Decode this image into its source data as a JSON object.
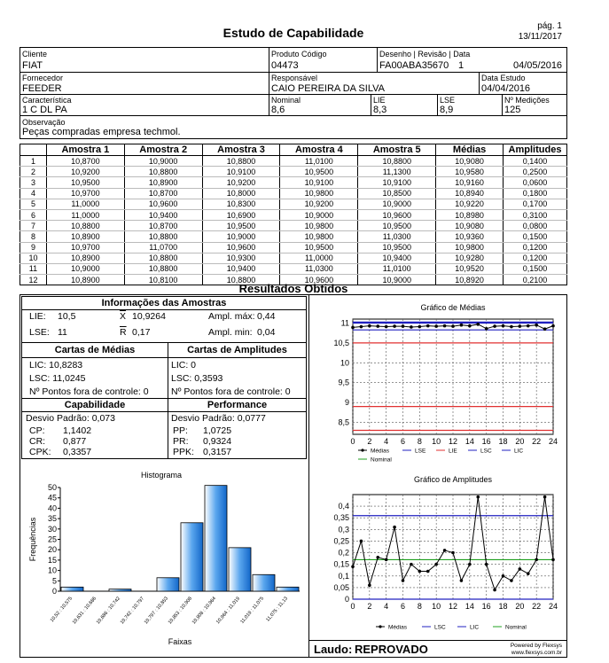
{
  "header": {
    "title": "Estudo de Capabilidade",
    "page": "pág. 1",
    "date": "13/11/2017"
  },
  "info": {
    "cliente_label": "Cliente",
    "cliente": "FIAT",
    "produto_label": "Produto Código",
    "produto": "04473",
    "desenho_label": "Desenho | Revisão | Data",
    "desenho": "FA00ABA35670",
    "revisao": "1",
    "desenho_data": "04/05/2016",
    "fornecedor_label": "Fornecedor",
    "fornecedor": "FEEDER",
    "responsavel_label": "Responsável",
    "responsavel": "CAIO PEREIRA DA SILVA",
    "data_estudo_label": "Data Estudo",
    "data_estudo": "04/04/2016",
    "caracteristica_label": "Característica",
    "caracteristica": "1  C DL PA",
    "nominal_label": "Nominal",
    "nominal": "8,6",
    "lie_label": "LIE",
    "lie": "8,3",
    "lse_label": "LSE",
    "lse": "8,9",
    "medicoes_label": "Nº Medições",
    "medicoes": "125",
    "obs_label": "Observação",
    "obs": "Peças compradas empresa techmol."
  },
  "table": {
    "headers": [
      "",
      "Amostra 1",
      "Amostra 2",
      "Amostra 3",
      "Amostra 4",
      "Amostra 5",
      "Médias",
      "Amplitudes"
    ],
    "rows": [
      [
        "1",
        "10,8700",
        "10,9000",
        "10,8800",
        "11,0100",
        "10,8800",
        "10,9080",
        "0,1400"
      ],
      [
        "2",
        "10,9200",
        "10,8800",
        "10,9100",
        "10,9500",
        "11,1300",
        "10,9580",
        "0,2500"
      ],
      [
        "3",
        "10,9500",
        "10,8900",
        "10,9200",
        "10,9100",
        "10,9100",
        "10,9160",
        "0,0600"
      ],
      [
        "4",
        "10,9700",
        "10,8700",
        "10,8000",
        "10,9800",
        "10,8500",
        "10,8940",
        "0,1800"
      ],
      [
        "5",
        "11,0000",
        "10,9600",
        "10,8300",
        "10,9200",
        "10,9000",
        "10,9220",
        "0,1700"
      ],
      [
        "6",
        "11,0000",
        "10,9400",
        "10,6900",
        "10,9000",
        "10,9600",
        "10,8980",
        "0,3100"
      ],
      [
        "7",
        "10,8800",
        "10,8700",
        "10,9500",
        "10,9800",
        "10,9500",
        "10,9080",
        "0,0800"
      ],
      [
        "8",
        "10,8900",
        "10,8800",
        "10,9000",
        "10,9800",
        "11,0300",
        "10,9360",
        "0,1500"
      ],
      [
        "9",
        "10,9700",
        "11,0700",
        "10,9600",
        "10,9500",
        "10,9500",
        "10,9800",
        "0,1200"
      ],
      [
        "10",
        "10,8900",
        "10,8800",
        "10,9300",
        "11,0000",
        "10,9400",
        "10,9280",
        "0,1200"
      ],
      [
        "11",
        "10,9000",
        "10,8800",
        "10,9400",
        "11,0300",
        "11,0100",
        "10,9520",
        "0,1500"
      ],
      [
        "12",
        "10,8900",
        "10,8100",
        "10,8800",
        "10,9600",
        "10,9000",
        "10,8920",
        "0,2100"
      ]
    ]
  },
  "results": {
    "title": "Resultados Obtidos",
    "info_title": "Informações das Amostras",
    "lie_l": "LIE:",
    "lie_v": "10,5",
    "xbar_l": "X",
    "xbar_v": "10,9264",
    "amax_l": "Ampl. máx:",
    "amax_v": "0,44",
    "lse_l": "LSE:",
    "lse_v": "11",
    "rbar_l": "R",
    "rbar_v": "0,17",
    "amin_l": "Ampl. min:",
    "amin_v": "0,04",
    "cm_title": "Cartas de Médias",
    "ca_title": "Cartas de Amplitudes",
    "cm_lic": "LIC:  10,8283",
    "cm_lsc": "LSC: 11,0245",
    "cm_pts": "Nº Pontos fora de controle: 0",
    "ca_lic": "LIC:  0",
    "ca_lsc": "LSC: 0,3593",
    "ca_pts": "Nº Pontos fora de controle: 0",
    "cap_title": "Capabilidade",
    "perf_title": "Performance",
    "cap_dp": "Desvio Padrão: 0,073",
    "perf_dp": "Desvio Padrão: 0,0777",
    "cp_l": "CP:",
    "cp_v": "1,1402",
    "cr_l": "CR:",
    "cr_v": "0,877",
    "cpk_l": "CPK:",
    "cpk_v": "0,3357",
    "pp_l": "PP:",
    "pp_v": "1,0725",
    "pr_l": "PR:",
    "pr_v": "0,9324",
    "ppk_l": "PPK:",
    "ppk_v": "0,3157",
    "laudo_l": "Laudo:",
    "laudo_v": "REPROVADO",
    "powered": "Powered by Flexsys",
    "site": "www.flexsys.com.br"
  },
  "chart_data": [
    {
      "type": "bar",
      "title": "Histograma",
      "xlabel": "Faixas",
      "ylabel": "Frequências",
      "ylim": [
        0,
        50
      ],
      "categories": [
        "10,52 : 10,575",
        "10,631 : 10,686",
        "10,686 : 10,742",
        "10,742 : 10,797",
        "10,797 : 10,853",
        "10,853 : 10,908",
        "10,908 : 10,964",
        "10,964 : 11,019",
        "11,019 : 11,075",
        "11,075 : 11,13"
      ],
      "values": [
        2,
        0,
        1,
        0,
        6.5,
        33,
        51,
        21,
        8,
        2
      ],
      "yticks": [
        "0",
        "5",
        "10",
        "15",
        "20",
        "25",
        "30",
        "35",
        "40",
        "45",
        "50"
      ],
      "xticks": [
        "10,52 : 10,575",
        "10,631 : 10,686",
        "10,686 : 10,742",
        "10,742 : 10,797",
        "10,797 : 10,853",
        "10,853 : 10,908",
        "10,908 : 10,964",
        "10,964 : 11,019",
        "11,019 : 11,075",
        "11,075 : 11,13"
      ]
    },
    {
      "type": "line",
      "title": "Gráfico de Médias",
      "ylim": [
        8.2,
        11.1
      ],
      "xlim": [
        0,
        24
      ],
      "xticks": [
        "0",
        "2",
        "4",
        "6",
        "8",
        "10",
        "12",
        "14",
        "16",
        "18",
        "20",
        "22",
        "24"
      ],
      "yticks": [
        "8,5",
        "9",
        "9,5",
        "10",
        "10,5",
        "11"
      ],
      "x": [
        0,
        1,
        2,
        3,
        4,
        5,
        6,
        7,
        8,
        9,
        10,
        11,
        12,
        13,
        14,
        15,
        16,
        17,
        18,
        19,
        20,
        21,
        22,
        23,
        24
      ],
      "series": [
        {
          "name": "Médias",
          "values": [
            10.89,
            10.91,
            10.93,
            10.92,
            10.91,
            10.92,
            10.92,
            10.9,
            10.91,
            10.93,
            10.92,
            10.93,
            10.92,
            10.95,
            10.93,
            10.97,
            10.86,
            10.92,
            10.93,
            10.91,
            10.92,
            10.93,
            10.95,
            10.85,
            10.93
          ]
        },
        {
          "name": "LSE",
          "values": [
            11
          ]
        },
        {
          "name": "LIE",
          "values": [
            10.5
          ]
        },
        {
          "name": "LSC",
          "values": [
            11.0245
          ]
        },
        {
          "name": "LIC",
          "values": [
            10.8283
          ]
        },
        {
          "name": "Nominal",
          "values": [
            8.6
          ]
        },
        {
          "name": "LSE",
          "values": [
            8.9
          ]
        },
        {
          "name": "LIE",
          "values": [
            8.3
          ]
        }
      ],
      "legend": [
        "Médias",
        "LSE",
        "LIE",
        "LSC",
        "LIC",
        "Nominal"
      ]
    },
    {
      "type": "line",
      "title": "Gráfico de Amplitudes",
      "ylim": [
        0,
        0.45
      ],
      "xlim": [
        0,
        24
      ],
      "xticks": [
        "0",
        "2",
        "4",
        "6",
        "8",
        "10",
        "12",
        "14",
        "16",
        "18",
        "20",
        "22",
        "24"
      ],
      "yticks": [
        "0",
        "0,05",
        "0,1",
        "0,15",
        "0,2",
        "0,25",
        "0,3",
        "0,35",
        "0,4"
      ],
      "x": [
        0,
        1,
        2,
        3,
        4,
        5,
        6,
        7,
        8,
        9,
        10,
        11,
        12,
        13,
        14,
        15,
        16,
        17,
        18,
        19,
        20,
        21,
        22,
        23,
        24
      ],
      "series": [
        {
          "name": "Médias",
          "values": [
            0.14,
            0.25,
            0.06,
            0.18,
            0.17,
            0.31,
            0.08,
            0.15,
            0.12,
            0.12,
            0.15,
            0.21,
            0.2,
            0.08,
            0.15,
            0.44,
            0.15,
            0.04,
            0.1,
            0.08,
            0.13,
            0.11,
            0.17,
            0.44,
            0.17
          ]
        },
        {
          "name": "LSC",
          "values": [
            0.3593
          ]
        },
        {
          "name": "LIC",
          "values": [
            0
          ]
        },
        {
          "name": "Nominal",
          "values": [
            0.17
          ]
        }
      ],
      "legend": [
        "Médias",
        "LSC",
        "LIC",
        "Nominal"
      ]
    }
  ]
}
